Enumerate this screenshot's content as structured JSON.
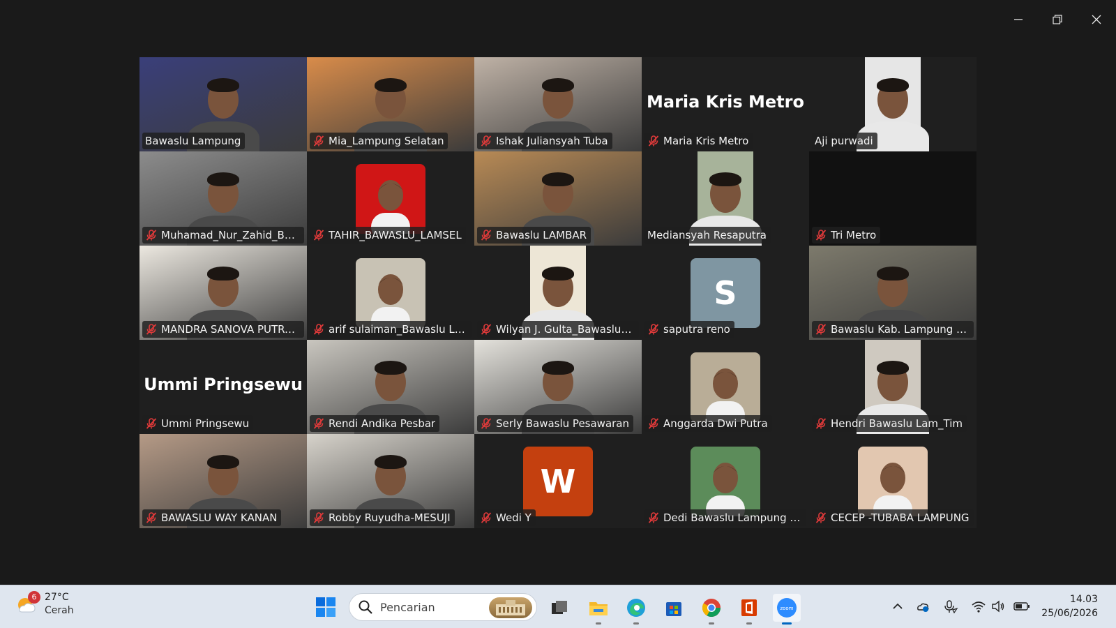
{
  "window": {
    "controls": [
      "minimize-icon",
      "restore-icon",
      "close-icon"
    ]
  },
  "gallery": {
    "active_speaker": "Bawaslu Lampung",
    "tiles": [
      {
        "name": "Bawaslu Lampung",
        "muted": false,
        "kind": "video",
        "bg": "#3a3f7a"
      },
      {
        "name": "Mia_Lampung Selatan",
        "muted": true,
        "kind": "video",
        "bg": "#d98c4a"
      },
      {
        "name": "Ishak Juliansyah Tuba",
        "muted": true,
        "kind": "video",
        "bg": "#bfb2a6"
      },
      {
        "name": "Maria Kris Metro",
        "muted": true,
        "kind": "name",
        "bg": "#1f1f1f",
        "big_text": "Maria Kris Metro"
      },
      {
        "name": "Aji purwadi",
        "muted": false,
        "kind": "video-narrow",
        "bg": "#e6e6e6"
      },
      {
        "name": "Muhamad_Nur_Zahid_Bawa...",
        "muted": true,
        "kind": "video",
        "bg": "#8c8c8c"
      },
      {
        "name": "TAHIR_BAWASLU_LAMSEL",
        "muted": true,
        "kind": "avatar-photo",
        "bg": "#d01616"
      },
      {
        "name": "Bawaslu LAMBAR",
        "muted": true,
        "kind": "video",
        "bg": "#b88a55"
      },
      {
        "name": "Mediansyah Resaputra",
        "muted": false,
        "kind": "video-narrow",
        "bg": "#a7b39a"
      },
      {
        "name": "Tri Metro",
        "muted": true,
        "kind": "blank",
        "bg": "#111111"
      },
      {
        "name": "MANDRA SANOVA PUTRA_B...",
        "muted": true,
        "kind": "video",
        "bg": "#ece8e0"
      },
      {
        "name": "arif sulaiman_Bawaslu Lam-...",
        "muted": true,
        "kind": "avatar-photo",
        "bg": "#c8c2b4"
      },
      {
        "name": "Wilyan J. Gulta_Bawaslu Pesi...",
        "muted": true,
        "kind": "video-narrow",
        "bg": "#ede6d6"
      },
      {
        "name": "saputra reno",
        "muted": true,
        "kind": "avatar-letter",
        "bg": "#7f96a2",
        "letter": "S"
      },
      {
        "name": "Bawaslu Kab. Lampung Utara",
        "muted": true,
        "kind": "video",
        "bg": "#7d7a6c"
      },
      {
        "name": "Ummi Pringsewu",
        "muted": true,
        "kind": "name",
        "bg": "#1f1f1f",
        "big_text": "Ummi Pringsewu"
      },
      {
        "name": "Rendi Andika Pesbar",
        "muted": true,
        "kind": "video",
        "bg": "#c9c6bf"
      },
      {
        "name": "Serly Bawaslu Pesawaran",
        "muted": true,
        "kind": "video",
        "bg": "#e4e2dc"
      },
      {
        "name": "Anggarda Dwi Putra",
        "muted": true,
        "kind": "avatar-photo",
        "bg": "#b9ad97"
      },
      {
        "name": "Hendri Bawaslu Lam_Tim",
        "muted": true,
        "kind": "video-narrow",
        "bg": "#cfc9c0"
      },
      {
        "name": "BAWASLU WAY KANAN",
        "muted": true,
        "kind": "video",
        "bg": "#b59a86"
      },
      {
        "name": "Robby Ruyudha-MESUJI",
        "muted": true,
        "kind": "video",
        "bg": "#d7d3cb"
      },
      {
        "name": "Wedi Y",
        "muted": true,
        "kind": "avatar-letter",
        "bg": "#c4400f",
        "letter": "W"
      },
      {
        "name": "Dedi Bawaslu Lampung Utara",
        "muted": true,
        "kind": "avatar-photo",
        "bg": "#5c8c5a"
      },
      {
        "name": "CECEP -TUBABA LAMPUNG",
        "muted": true,
        "kind": "avatar-photo",
        "bg": "#e2c7b0"
      }
    ]
  },
  "taskbar": {
    "weather": {
      "temp": "27°C",
      "condition": "Cerah",
      "badge": "6"
    },
    "search_placeholder": "Pencarian",
    "apps": [
      "task-view-icon",
      "file-explorer-icon",
      "edge-icon",
      "microsoft-store-icon",
      "chrome-icon",
      "office-icon",
      "zoom-icon"
    ],
    "clock": {
      "time": "14.03",
      "date": "25/06/2026"
    },
    "colors": {
      "accent": "#0067c0",
      "active_speaker": "#23d959",
      "mute_red": "#e03a3a"
    }
  }
}
